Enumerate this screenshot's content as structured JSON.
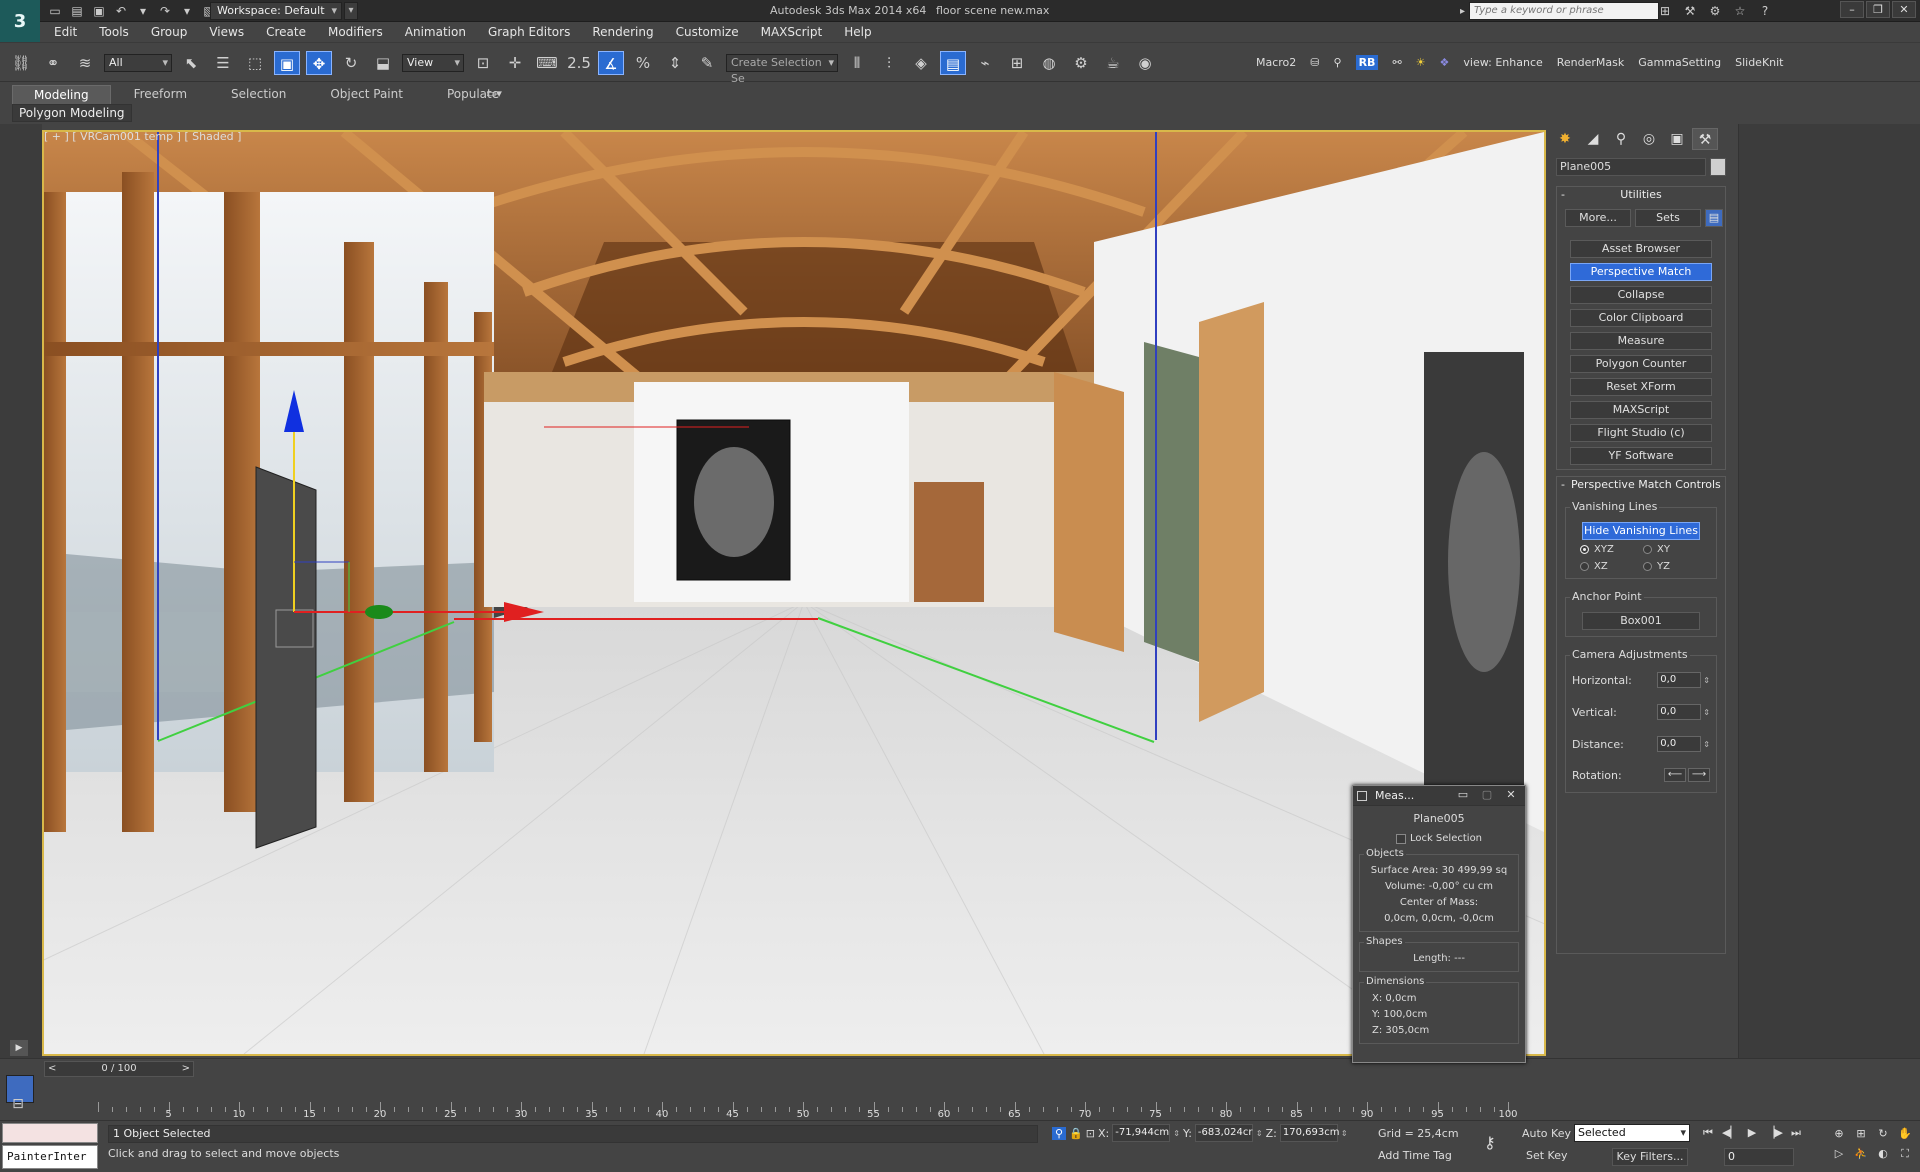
{
  "title_bar": {
    "app_title": "Autodesk 3ds Max  2014 x64",
    "file_name": "floor scene new.max",
    "workspace": "Workspace: Default",
    "search_placeholder": "Type a keyword or phrase"
  },
  "menu": [
    "Edit",
    "Tools",
    "Group",
    "Views",
    "Create",
    "Modifiers",
    "Animation",
    "Graph Editors",
    "Rendering",
    "Customize",
    "MAXScript",
    "Help"
  ],
  "toolbar": {
    "selection_filter": "All",
    "ref_coord": "View",
    "snap_value": "2.5",
    "named_selection_placeholder": "Create Selection Se",
    "right_items": [
      "Macro2",
      "view: Enhance",
      "RenderMask",
      "GammaSetting",
      "SlideKnit"
    ],
    "rb_label": "RB"
  },
  "ribbon": {
    "tabs": [
      "Modeling",
      "Freeform",
      "Selection",
      "Object Paint",
      "Populate"
    ],
    "active_tab": "Modeling",
    "panel_label": "Polygon Modeling"
  },
  "viewport": {
    "label": "[ + ] [ VRCam001 temp ] [ Shaded ]",
    "colors": {
      "border": "#d8b84a",
      "vanish_red": "#e02020",
      "vanish_green": "#40d040",
      "vanish_blue": "#3040c0"
    }
  },
  "command_panel": {
    "object_name": "Plane005",
    "utilities_title": "Utilities",
    "more_btn": "More...",
    "sets_btn": "Sets",
    "utility_buttons": [
      "Asset Browser",
      "Perspective Match",
      "Collapse",
      "Color Clipboard",
      "Measure",
      "Polygon Counter",
      "Reset XForm",
      "MAXScript",
      "Flight Studio (c)",
      "YF Software"
    ],
    "active_utility": "Perspective Match",
    "pm_title": "Perspective Match Controls",
    "vanishing_lines_title": "Vanishing Lines",
    "hide_vanishing_btn": "Hide Vanishing Lines",
    "radio_options": [
      "XYZ",
      "XY",
      "XZ",
      "YZ"
    ],
    "radio_selected": "XYZ",
    "anchor_title": "Anchor Point",
    "anchor_btn": "Box001",
    "camera_adj_title": "Camera Adjustments",
    "horizontal_label": "Horizontal:",
    "horizontal_val": "0,0",
    "vertical_label": "Vertical:",
    "vertical_val": "0,0",
    "distance_label": "Distance:",
    "distance_val": "0,0",
    "rotation_label": "Rotation:"
  },
  "measure": {
    "title": "Meas...",
    "object": "Plane005",
    "lock_label": "Lock Selection",
    "objects_title": "Objects",
    "surface_area": "Surface Area: 30 499,99 sq",
    "volume": "Volume: -0,00° cu cm",
    "center_label": "Center of Mass:",
    "center_val": "0,0cm, 0,0cm, -0,0cm",
    "shapes_title": "Shapes",
    "length": "Length: ---",
    "dimensions_title": "Dimensions",
    "dim_x": "X:  0,0cm",
    "dim_y": "Y:  100,0cm",
    "dim_z": "Z:  305,0cm"
  },
  "timeline": {
    "frame_display": "0 / 100",
    "ticks": [
      "5",
      "10",
      "15",
      "20",
      "25",
      "30",
      "35",
      "40",
      "45",
      "50",
      "55",
      "60",
      "65",
      "70",
      "75",
      "80",
      "85",
      "90",
      "95",
      "100"
    ]
  },
  "status": {
    "selection": "1 Object Selected",
    "prompt": "Click and drag to select and move objects",
    "maxscript_text": "PainterInter",
    "x_label": "X:",
    "x_val": "-71,944cm",
    "y_label": "Y:",
    "y_val": "-683,024cr",
    "z_label": "Z:",
    "z_val": "170,693cm",
    "grid": "Grid = 25,4cm",
    "add_time_tag": "Add Time Tag",
    "auto_key": "Auto Key",
    "set_key": "Set Key",
    "selected_dd": "Selected",
    "key_filters": "Key Filters...",
    "frame_val": "0"
  }
}
